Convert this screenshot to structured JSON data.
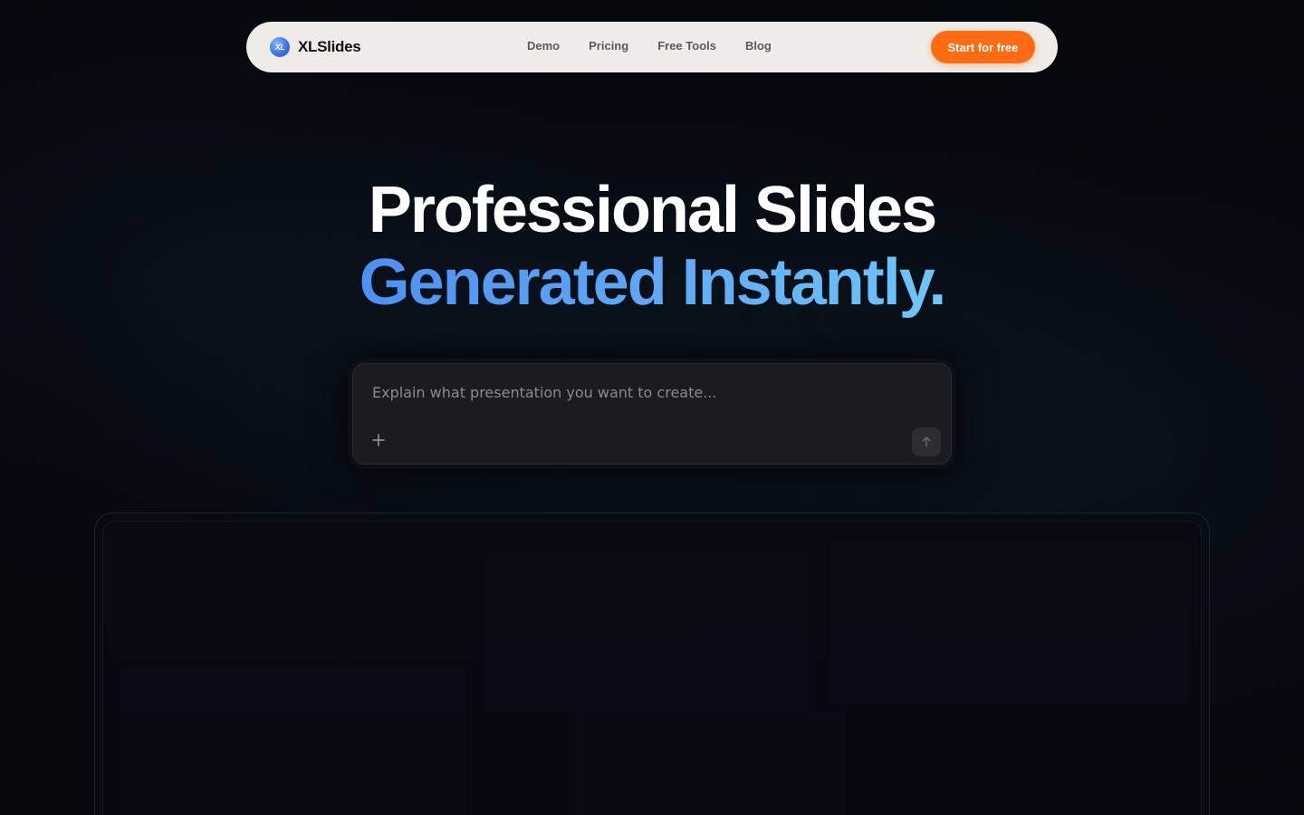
{
  "navbar": {
    "logo_text": "XL",
    "brand_name": "XLSlides",
    "links": [
      "Demo",
      "Pricing",
      "Free Tools",
      "Blog"
    ],
    "cta_label": "Start for free"
  },
  "hero": {
    "title_line1": "Professional Slides",
    "title_line2": "Generated Instantly."
  },
  "prompt": {
    "placeholder": "Explain what presentation you want to create...",
    "value": "",
    "attach_icon": "plus-icon",
    "send_icon": "arrow-up-icon"
  },
  "colors": {
    "background": "#05080d",
    "navbar_bg": "#efece7",
    "cta": "#ff6b12",
    "gradient_start": "#4e8ff2",
    "gradient_end": "#6fc6f8",
    "prompt_bg": "#1b1c1f"
  }
}
